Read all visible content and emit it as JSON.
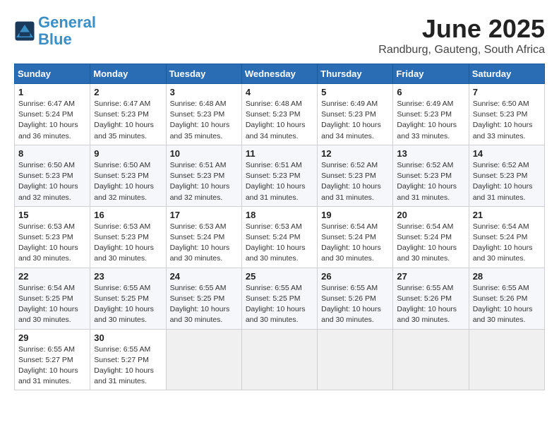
{
  "header": {
    "logo_line1": "General",
    "logo_line2": "Blue",
    "title": "June 2025",
    "subtitle": "Randburg, Gauteng, South Africa"
  },
  "days_of_week": [
    "Sunday",
    "Monday",
    "Tuesday",
    "Wednesday",
    "Thursday",
    "Friday",
    "Saturday"
  ],
  "weeks": [
    [
      {
        "day": "1",
        "detail": "Sunrise: 6:47 AM\nSunset: 5:24 PM\nDaylight: 10 hours\nand 36 minutes."
      },
      {
        "day": "2",
        "detail": "Sunrise: 6:47 AM\nSunset: 5:23 PM\nDaylight: 10 hours\nand 35 minutes."
      },
      {
        "day": "3",
        "detail": "Sunrise: 6:48 AM\nSunset: 5:23 PM\nDaylight: 10 hours\nand 35 minutes."
      },
      {
        "day": "4",
        "detail": "Sunrise: 6:48 AM\nSunset: 5:23 PM\nDaylight: 10 hours\nand 34 minutes."
      },
      {
        "day": "5",
        "detail": "Sunrise: 6:49 AM\nSunset: 5:23 PM\nDaylight: 10 hours\nand 34 minutes."
      },
      {
        "day": "6",
        "detail": "Sunrise: 6:49 AM\nSunset: 5:23 PM\nDaylight: 10 hours\nand 33 minutes."
      },
      {
        "day": "7",
        "detail": "Sunrise: 6:50 AM\nSunset: 5:23 PM\nDaylight: 10 hours\nand 33 minutes."
      }
    ],
    [
      {
        "day": "8",
        "detail": "Sunrise: 6:50 AM\nSunset: 5:23 PM\nDaylight: 10 hours\nand 32 minutes."
      },
      {
        "day": "9",
        "detail": "Sunrise: 6:50 AM\nSunset: 5:23 PM\nDaylight: 10 hours\nand 32 minutes."
      },
      {
        "day": "10",
        "detail": "Sunrise: 6:51 AM\nSunset: 5:23 PM\nDaylight: 10 hours\nand 32 minutes."
      },
      {
        "day": "11",
        "detail": "Sunrise: 6:51 AM\nSunset: 5:23 PM\nDaylight: 10 hours\nand 31 minutes."
      },
      {
        "day": "12",
        "detail": "Sunrise: 6:52 AM\nSunset: 5:23 PM\nDaylight: 10 hours\nand 31 minutes."
      },
      {
        "day": "13",
        "detail": "Sunrise: 6:52 AM\nSunset: 5:23 PM\nDaylight: 10 hours\nand 31 minutes."
      },
      {
        "day": "14",
        "detail": "Sunrise: 6:52 AM\nSunset: 5:23 PM\nDaylight: 10 hours\nand 31 minutes."
      }
    ],
    [
      {
        "day": "15",
        "detail": "Sunrise: 6:53 AM\nSunset: 5:23 PM\nDaylight: 10 hours\nand 30 minutes."
      },
      {
        "day": "16",
        "detail": "Sunrise: 6:53 AM\nSunset: 5:23 PM\nDaylight: 10 hours\nand 30 minutes."
      },
      {
        "day": "17",
        "detail": "Sunrise: 6:53 AM\nSunset: 5:24 PM\nDaylight: 10 hours\nand 30 minutes."
      },
      {
        "day": "18",
        "detail": "Sunrise: 6:53 AM\nSunset: 5:24 PM\nDaylight: 10 hours\nand 30 minutes."
      },
      {
        "day": "19",
        "detail": "Sunrise: 6:54 AM\nSunset: 5:24 PM\nDaylight: 10 hours\nand 30 minutes."
      },
      {
        "day": "20",
        "detail": "Sunrise: 6:54 AM\nSunset: 5:24 PM\nDaylight: 10 hours\nand 30 minutes."
      },
      {
        "day": "21",
        "detail": "Sunrise: 6:54 AM\nSunset: 5:24 PM\nDaylight: 10 hours\nand 30 minutes."
      }
    ],
    [
      {
        "day": "22",
        "detail": "Sunrise: 6:54 AM\nSunset: 5:25 PM\nDaylight: 10 hours\nand 30 minutes."
      },
      {
        "day": "23",
        "detail": "Sunrise: 6:55 AM\nSunset: 5:25 PM\nDaylight: 10 hours\nand 30 minutes."
      },
      {
        "day": "24",
        "detail": "Sunrise: 6:55 AM\nSunset: 5:25 PM\nDaylight: 10 hours\nand 30 minutes."
      },
      {
        "day": "25",
        "detail": "Sunrise: 6:55 AM\nSunset: 5:25 PM\nDaylight: 10 hours\nand 30 minutes."
      },
      {
        "day": "26",
        "detail": "Sunrise: 6:55 AM\nSunset: 5:26 PM\nDaylight: 10 hours\nand 30 minutes."
      },
      {
        "day": "27",
        "detail": "Sunrise: 6:55 AM\nSunset: 5:26 PM\nDaylight: 10 hours\nand 30 minutes."
      },
      {
        "day": "28",
        "detail": "Sunrise: 6:55 AM\nSunset: 5:26 PM\nDaylight: 10 hours\nand 30 minutes."
      }
    ],
    [
      {
        "day": "29",
        "detail": "Sunrise: 6:55 AM\nSunset: 5:27 PM\nDaylight: 10 hours\nand 31 minutes."
      },
      {
        "day": "30",
        "detail": "Sunrise: 6:55 AM\nSunset: 5:27 PM\nDaylight: 10 hours\nand 31 minutes."
      },
      {
        "day": "",
        "detail": ""
      },
      {
        "day": "",
        "detail": ""
      },
      {
        "day": "",
        "detail": ""
      },
      {
        "day": "",
        "detail": ""
      },
      {
        "day": "",
        "detail": ""
      }
    ]
  ]
}
